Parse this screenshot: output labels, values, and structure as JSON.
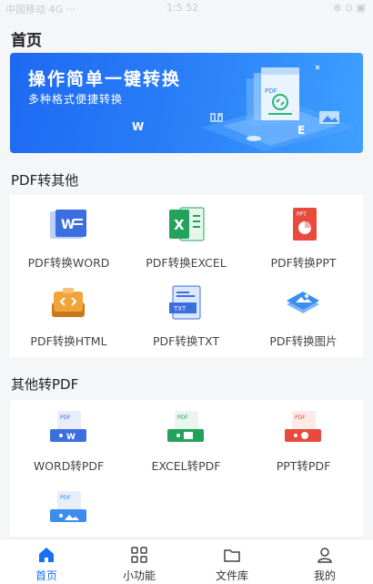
{
  "status_bar": {
    "carrier": "中国移动 4G ···",
    "time": "1:5 52",
    "indicators": "⊕ ⊙ ▣"
  },
  "page_title": "首页",
  "banner": {
    "title": "操作简单一键转换",
    "subtitle": "多种格式便捷转换",
    "doc_label": "PDF",
    "w_letter": "W",
    "e_letter": "E"
  },
  "section1": {
    "title": "PDF转其他",
    "items": [
      {
        "label": "PDF转换WORD",
        "icon": "word-doc-icon"
      },
      {
        "label": "PDF转换EXCEL",
        "icon": "excel-doc-icon"
      },
      {
        "label": "PDF转换PPT",
        "icon": "ppt-doc-icon"
      },
      {
        "label": "PDF转换HTML",
        "icon": "html-doc-icon"
      },
      {
        "label": "PDF转换TXT",
        "icon": "txt-doc-icon"
      },
      {
        "label": "PDF转换图片",
        "icon": "image-doc-icon"
      }
    ]
  },
  "section2": {
    "title": "其他转PDF",
    "items": [
      {
        "label": "WORD转PDF",
        "icon": "word-to-pdf-icon"
      },
      {
        "label": "EXCEL转PDF",
        "icon": "excel-to-pdf-icon"
      },
      {
        "label": "PPT转PDF",
        "icon": "ppt-to-pdf-icon"
      },
      {
        "label": "",
        "icon": "image-to-pdf-icon"
      }
    ]
  },
  "icon_text": {
    "word_letter": "W",
    "excel_letter": "X",
    "ppt_tag": "PPT",
    "txt_tag": "TXT",
    "pdf_tag": "PDF"
  },
  "tabs": [
    {
      "label": "首页",
      "icon": "home-icon",
      "active": true
    },
    {
      "label": "小功能",
      "icon": "grid-icon",
      "active": false
    },
    {
      "label": "文件库",
      "icon": "folder-icon",
      "active": false
    },
    {
      "label": "我的",
      "icon": "user-icon",
      "active": false
    }
  ],
  "colors": {
    "primary": "#1a6ff0",
    "word": "#3b6fe0",
    "excel": "#22a25a",
    "ppt": "#e84b3c",
    "html": "#e8952b"
  }
}
